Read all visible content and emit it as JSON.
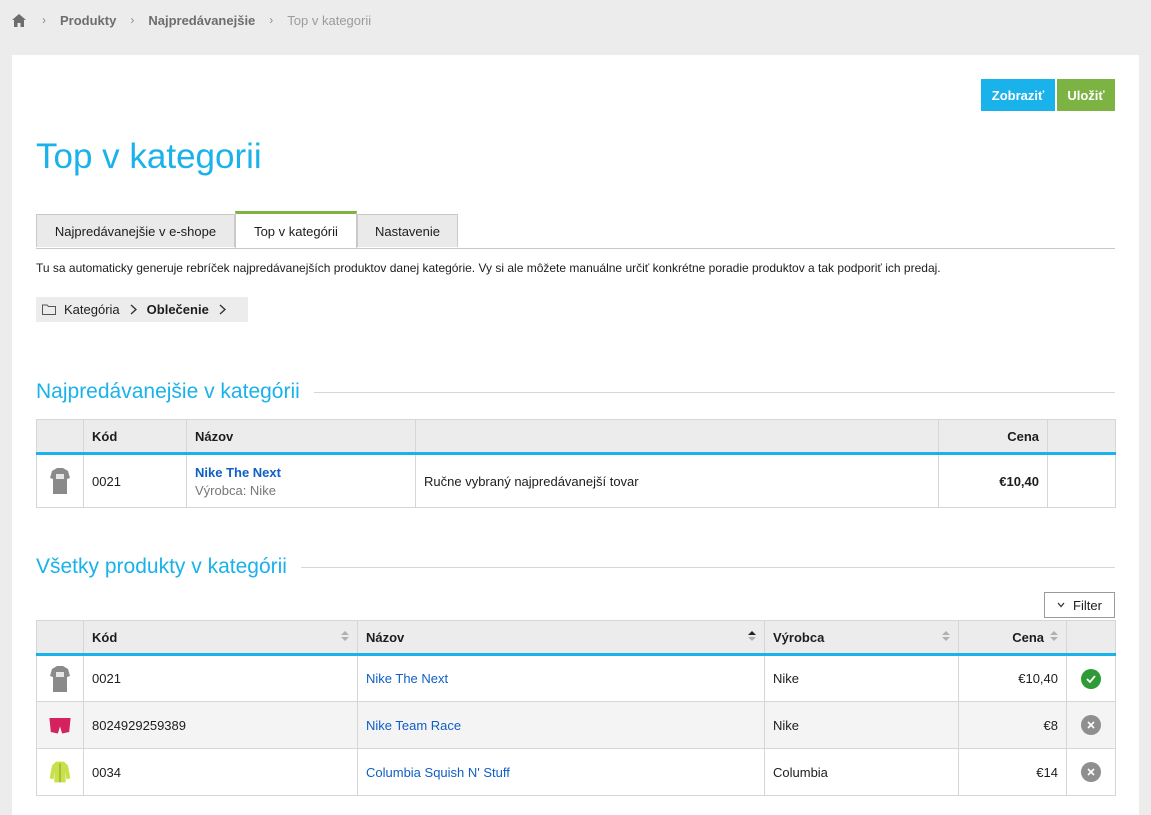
{
  "breadcrumb": {
    "home_icon": "home-icon",
    "items": [
      "Produkty",
      "Najpredávanejšie"
    ],
    "current": "Top v kategorii"
  },
  "toolbar": {
    "show_label": "Zobraziť",
    "save_label": "Uložiť"
  },
  "page_title": "Top v kategorii",
  "tabs": [
    {
      "label": "Najpredávanejšie v e-shope",
      "active": false
    },
    {
      "label": "Top v kategórii",
      "active": true
    },
    {
      "label": "Nastavenie",
      "active": false
    }
  ],
  "description": "Tu sa automaticky generuje rebríček najpredávanejších produktov danej kategórie. Vy si ale môžete manuálne určiť konkrétne poradie produktov a tak podporiť ich predaj.",
  "category_crumb": {
    "root": "Kategória",
    "current": "Oblečenie"
  },
  "top_section": {
    "title": "Najpredávanejšie v kategórii",
    "headers": {
      "code": "Kód",
      "name": "Názov",
      "note": "",
      "price": "Cena"
    },
    "rows": [
      {
        "code": "0021",
        "name": "Nike The Next",
        "maker": "Výrobca: Nike",
        "note": "Ručne vybraný najpredávanejší tovar",
        "price": "€10,40"
      }
    ]
  },
  "all_section": {
    "title": "Všetky produkty v kategórii",
    "filter_label": "Filter",
    "headers": {
      "code": "Kód",
      "name": "Názov",
      "maker": "Výrobca",
      "price": "Cena"
    },
    "rows": [
      {
        "code": "0021",
        "name": "Nike The Next",
        "maker": "Nike",
        "price": "€10,40",
        "status": "check-icon"
      },
      {
        "code": "8024929259389",
        "name": "Nike Team Race",
        "maker": "Nike",
        "price": "€8",
        "status": "remove-icon"
      },
      {
        "code": "0034",
        "name": "Columbia Squish N' Stuff",
        "maker": "Columbia",
        "price": "€14",
        "status": "remove-icon"
      }
    ]
  },
  "colors": {
    "accent": "#19b2ea",
    "save": "#7cb342",
    "link": "#0f5fc5",
    "ok": "#2e9b36"
  }
}
